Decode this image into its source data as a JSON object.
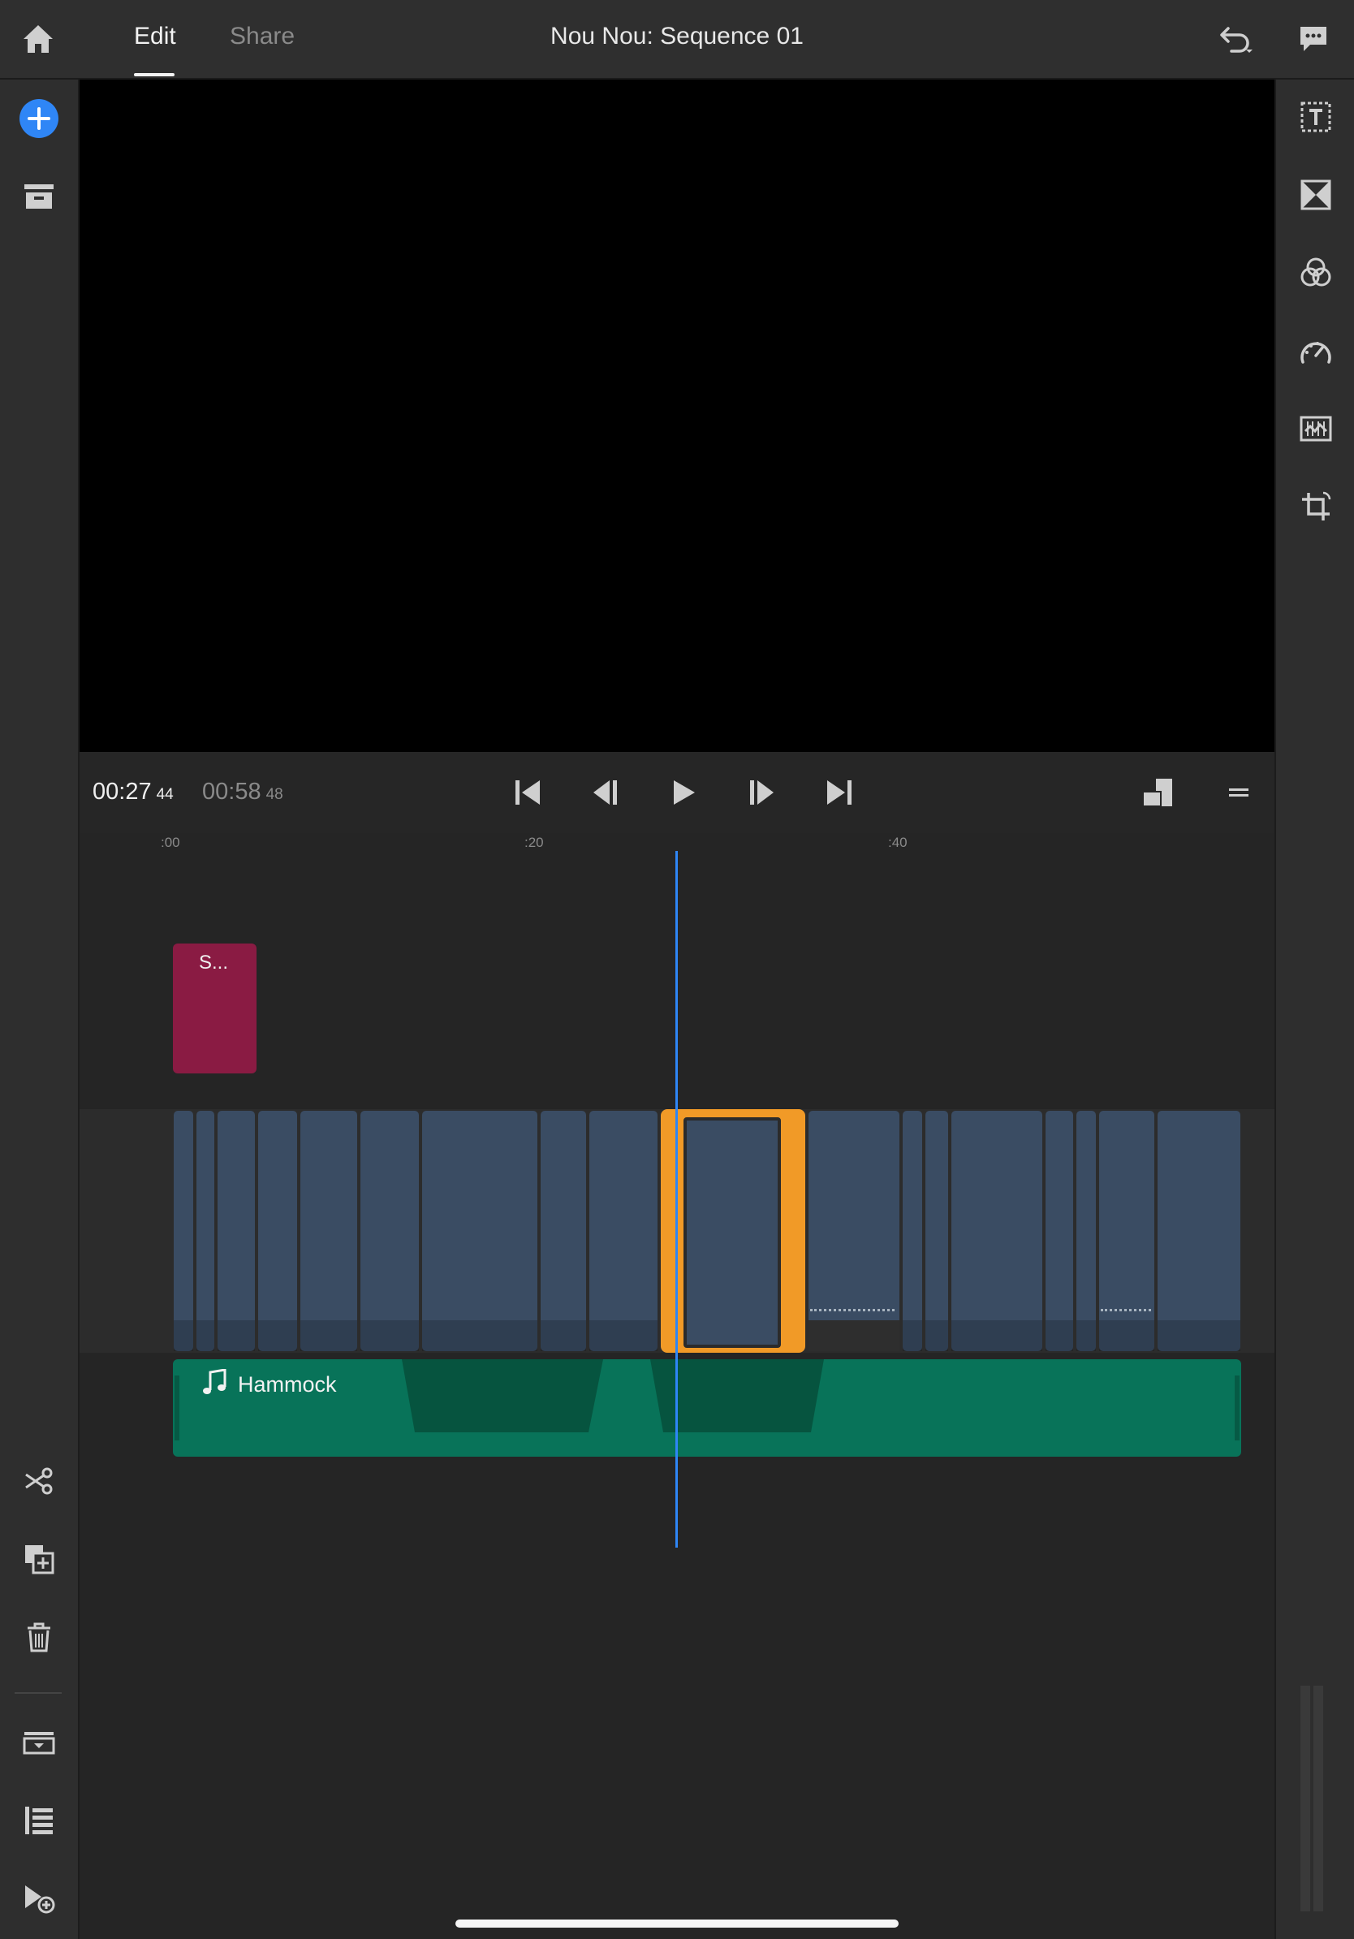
{
  "header": {
    "tabs": [
      {
        "label": "Edit",
        "active": true
      },
      {
        "label": "Share",
        "active": false
      }
    ],
    "title": "Nou Nou: Sequence 01",
    "icons": [
      "home-icon",
      "undo-icon",
      "feedback-icon"
    ]
  },
  "left_toolbar": {
    "top_icons": [
      "add-media-icon",
      "project-panel-icon"
    ],
    "bottom_icons": [
      "split-icon",
      "duplicate-icon",
      "delete-icon",
      "track-panel-icon",
      "track-list-icon",
      "add-track-icon"
    ]
  },
  "right_toolbar": {
    "icons": [
      "titles-icon",
      "transitions-icon",
      "color-icon",
      "speed-icon",
      "audio-icon",
      "transform-crop-icon"
    ]
  },
  "transport": {
    "current_time": "00:27",
    "current_frame": "44",
    "total_time": "00:58",
    "total_frame": "48",
    "icons": [
      "go-to-start-icon",
      "step-back-icon",
      "play-icon",
      "step-forward-icon",
      "go-to-end-icon",
      "track-height-icon",
      "menu-icon"
    ]
  },
  "ruler": {
    "ticks": [
      ":00",
      ":20",
      ":40"
    ]
  },
  "timeline": {
    "title_clip_label": "S...",
    "audio_clip_label": "Hammock"
  },
  "colors": {
    "accent_blue": "#2f86f6",
    "selection_orange": "#f19a27",
    "video_clip": "#3a4c63",
    "title_clip": "#8a1b43",
    "audio_clip": "#087359"
  }
}
